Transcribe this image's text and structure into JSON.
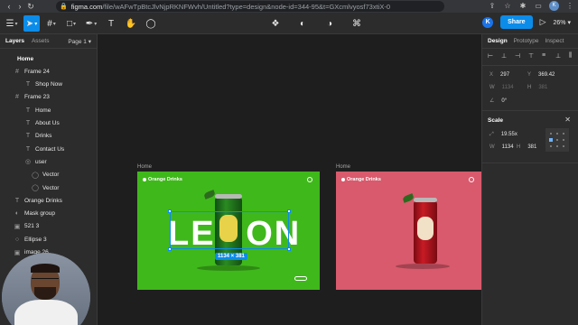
{
  "browser": {
    "url_host": "figma.com",
    "url_path": "/file/wAFwTpBtcJlvNjpRKNFWvh/Untitled?type=design&node-id=344-95&t=GXcmlvyosf73xtiX-0"
  },
  "toolbar": {
    "user_initial": "K",
    "share_label": "Share",
    "zoom_label": "26%"
  },
  "left_panel": {
    "tabs": [
      "Layers",
      "Assets"
    ],
    "page_label": "Page 1",
    "layers": [
      {
        "label": "Home",
        "icon": "page-icon"
      },
      {
        "label": "Frame 24",
        "icon": "frame-icon"
      },
      {
        "label": "Shop Now",
        "icon": "text-icon"
      },
      {
        "label": "Frame 23",
        "icon": "frame-icon"
      },
      {
        "label": "Home",
        "icon": "text-icon"
      },
      {
        "label": "About Us",
        "icon": "text-icon"
      },
      {
        "label": "Drinks",
        "icon": "text-icon"
      },
      {
        "label": "Contact Us",
        "icon": "text-icon"
      },
      {
        "label": "user",
        "icon": "component-icon"
      },
      {
        "label": "Vector",
        "icon": "vector-icon"
      },
      {
        "label": "Vector",
        "icon": "vector-icon"
      },
      {
        "label": "Orange Drinks",
        "icon": "text-icon"
      },
      {
        "label": "Mask group",
        "icon": "mask-icon"
      },
      {
        "label": "521 3",
        "icon": "image-icon"
      },
      {
        "label": "Ellipse 3",
        "icon": "ellipse-icon"
      },
      {
        "label": "image 26",
        "icon": "image-icon"
      }
    ]
  },
  "canvas": {
    "frame1_label": "Home",
    "frame2_label": "Home",
    "frame1": {
      "logo": "Orange Drinks",
      "hero_text": "LEMON",
      "bg_color": "#3fb81b"
    },
    "frame2": {
      "logo": "Orange Drinks",
      "bg_color": "#d85a6c"
    },
    "selection_size": "1134 × 381"
  },
  "right_panel": {
    "tabs": [
      "Design",
      "Prototype",
      "Inspect"
    ],
    "x_label": "X",
    "x_value": "297",
    "y_label": "Y",
    "y_value": "369.42",
    "w_label": "W",
    "w_value": "1134",
    "h_label": "H",
    "h_value": "381",
    "rotation_value": "0°",
    "scale_title": "Scale",
    "scale_factor": "19.55x",
    "scale_w_label": "W",
    "scale_w_value": "1134",
    "scale_h_label": "H",
    "scale_h_value": "381"
  },
  "colors": {
    "accent": "#0c8ce9",
    "panel_bg": "#2c2c2c",
    "canvas_bg": "#1e1e1e"
  }
}
